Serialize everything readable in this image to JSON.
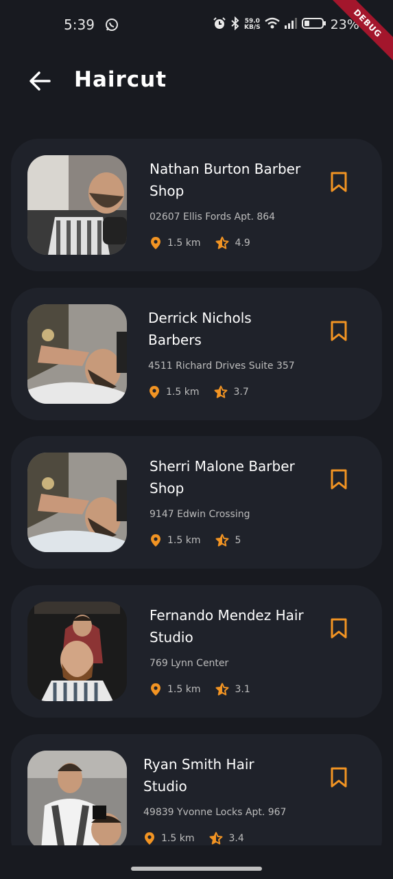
{
  "status_bar": {
    "time": "5:39",
    "net_speed_value": "59.0",
    "net_speed_unit": "KB/S",
    "battery": "23%",
    "debug_label": "DEBUG"
  },
  "app_bar": {
    "title": "Haircut",
    "back_icon": "arrow-left-icon"
  },
  "colors": {
    "background": "#181a20",
    "card": "#1f222a",
    "accent": "#f29423",
    "text_secondary": "#bdbdbd"
  },
  "shops": [
    {
      "name": "Nathan Burton Barber Shop",
      "address": "02607 Ellis Fords Apt. 864",
      "distance": "1.5 km",
      "rating": "4.9"
    },
    {
      "name": "Derrick Nichols Barbers",
      "address": "4511 Richard Drives Suite 357",
      "distance": "1.5 km",
      "rating": "3.7"
    },
    {
      "name": "Sherri Malone Barber Shop",
      "address": "9147 Edwin Crossing",
      "distance": "1.5 km",
      "rating": "5"
    },
    {
      "name": "Fernando Mendez Hair Studio",
      "address": "769 Lynn Center",
      "distance": "1.5 km",
      "rating": "3.1"
    },
    {
      "name": "Ryan Smith Hair Studio",
      "address": "49839 Yvonne Locks Apt. 967",
      "distance": "1.5 km",
      "rating": "3.4"
    }
  ]
}
